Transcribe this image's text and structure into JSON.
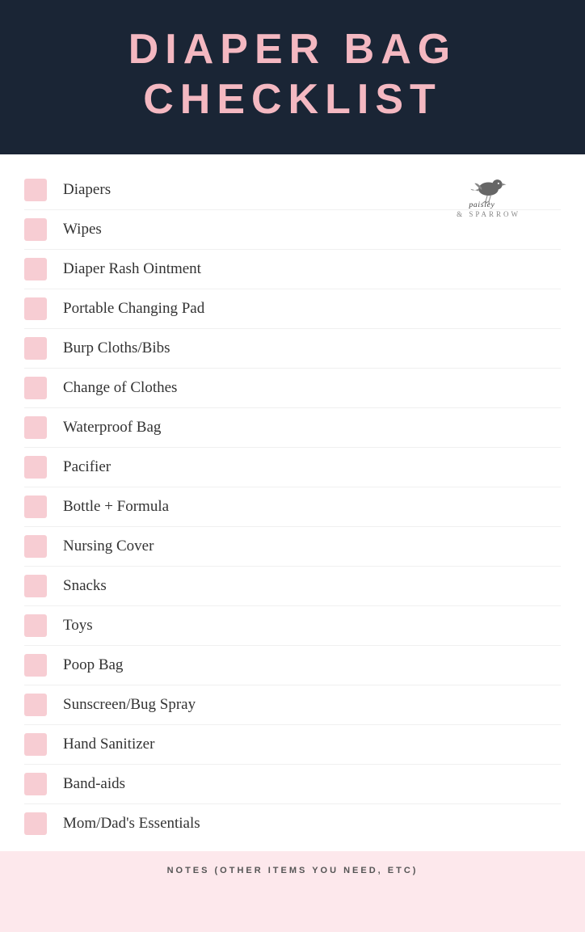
{
  "header": {
    "line1": "DIAPER BAG",
    "line2": "CHECKLIST"
  },
  "logo": {
    "script_text": "paisley",
    "sub_text": "& SPARROW"
  },
  "checklist": {
    "items": [
      "Diapers",
      "Wipes",
      "Diaper Rash Ointment",
      "Portable Changing Pad",
      "Burp Cloths/Bibs",
      "Change of Clothes",
      "Waterproof Bag",
      "Pacifier",
      "Bottle + Formula",
      "Nursing Cover",
      "Snacks",
      "Toys",
      "Poop Bag",
      "Sunscreen/Bug Spray",
      "Hand Sanitizer",
      "Band-aids",
      "Mom/Dad's Essentials"
    ]
  },
  "footer": {
    "label": "NOTES (OTHER ITEMS YOU NEED, ETC)"
  },
  "colors": {
    "header_bg": "#1a2535",
    "title_color": "#f4b8c1",
    "checkbox_color": "#f4b8c1",
    "footer_bg": "#fde8ec"
  }
}
